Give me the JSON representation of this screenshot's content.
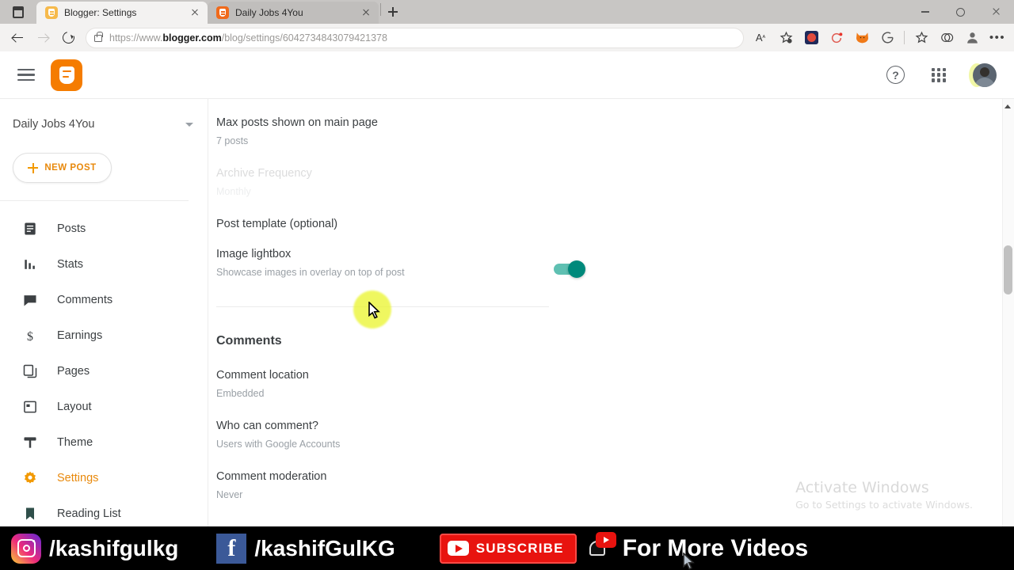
{
  "browser": {
    "tabs": [
      {
        "title": "Blogger: Settings",
        "favicon": "blogger-favicon-light",
        "active": true
      },
      {
        "title": "Daily Jobs 4You",
        "favicon": "blogger-favicon-dark",
        "active": false
      }
    ],
    "url": {
      "scheme": "https://www.",
      "domain": "blogger.com",
      "path": "/blog/settings/6042734843079421378",
      "full": "https://www.blogger.com/blog/settings/6042734843079421378"
    },
    "toolbar_icons": [
      "read-aloud-icon",
      "favorites-add-icon",
      "extension-app-icon",
      "extension-refresh-icon",
      "extension-fox-icon",
      "extension-ghost-icon",
      "collections-icon",
      "browser-essentials-icon",
      "profile-icon",
      "more-options-icon"
    ],
    "window_controls": [
      "minimize",
      "maximize",
      "close"
    ]
  },
  "app_header": {
    "menu_label": "main-menu",
    "logo_label": "Blogger",
    "help_label": "?",
    "icons": [
      "help-icon",
      "google-apps-icon",
      "account-avatar"
    ]
  },
  "sidebar": {
    "blog_name": "Daily Jobs 4You",
    "new_post_label": "NEW POST",
    "items": [
      {
        "label": "Posts",
        "icon": "posts-icon",
        "active": false
      },
      {
        "label": "Stats",
        "icon": "stats-icon",
        "active": false
      },
      {
        "label": "Comments",
        "icon": "comments-icon",
        "active": false
      },
      {
        "label": "Earnings",
        "icon": "earnings-icon",
        "active": false
      },
      {
        "label": "Pages",
        "icon": "pages-icon",
        "active": false
      },
      {
        "label": "Layout",
        "icon": "layout-icon",
        "active": false
      },
      {
        "label": "Theme",
        "icon": "theme-icon",
        "active": false
      },
      {
        "label": "Settings",
        "icon": "settings-gear-icon",
        "active": true
      },
      {
        "label": "Reading List",
        "icon": "reading-list-icon",
        "active": false
      }
    ],
    "accent_color": "#e8890c"
  },
  "main": {
    "settings": [
      {
        "title": "Max posts shown on main page",
        "value": "7 posts",
        "faded": false
      },
      {
        "title": "Archive Frequency",
        "value": "Monthly",
        "faded": true
      },
      {
        "title": "Post template (optional)",
        "value": "",
        "faded": false
      }
    ],
    "image_lightbox": {
      "title": "Image lightbox",
      "description": "Showcase images in overlay on top of post",
      "toggle_on": true,
      "toggle_color": "#00897b"
    },
    "comments_section": {
      "heading": "Comments",
      "items": [
        {
          "title": "Comment location",
          "value": "Embedded"
        },
        {
          "title": "Who can comment?",
          "value": "Users with Google Accounts"
        },
        {
          "title": "Comment moderation",
          "value": "Never"
        }
      ]
    }
  },
  "watermark": {
    "line1": "Activate Windows",
    "line2": "Go to Settings to activate Windows."
  },
  "banner": {
    "instagram_handle": "/kashifgulkg",
    "facebook_handle": "/kashifGulKG",
    "subscribe_label": "SUBSCRIBE",
    "tagline": "For More Videos",
    "background": "#000000",
    "subscribe_color": "#e8130f"
  }
}
